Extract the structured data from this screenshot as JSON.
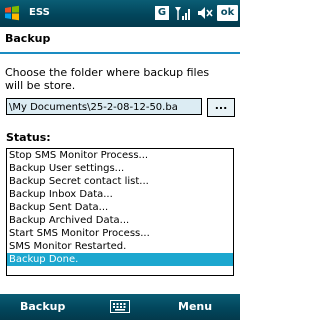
{
  "status_bar": {
    "app_title": "ESS",
    "g_icon_label": "G",
    "ok_label": "ok",
    "icons": [
      "windows-logo-icon",
      "signal-strength-icon",
      "speaker-icon"
    ]
  },
  "header": {
    "title": "Backup"
  },
  "instruction": "Choose the folder where backup files will be store.",
  "path_field": {
    "value": "\\My Documents\\25-2-08-12-50.ba",
    "browse_label": "..."
  },
  "status": {
    "label": "Status:",
    "items": [
      "Stop SMS Monitor Process...",
      "Backup User settings...",
      "Backup Secret contact list...",
      "Backup Inbox Data...",
      "Backup Sent Data...",
      "Backup Archived Data...",
      "Start SMS Monitor Process...",
      "SMS Monitor Restarted.",
      "Backup Done."
    ],
    "selected_index": 8
  },
  "softkeys": {
    "left": "Backup",
    "right": "Menu",
    "center_icon": "keyboard-icon"
  },
  "colors": {
    "bar": "#02465c",
    "accent": "#1a8cc2",
    "selection": "#1da7cf",
    "field_bg": "#dcecf3"
  }
}
